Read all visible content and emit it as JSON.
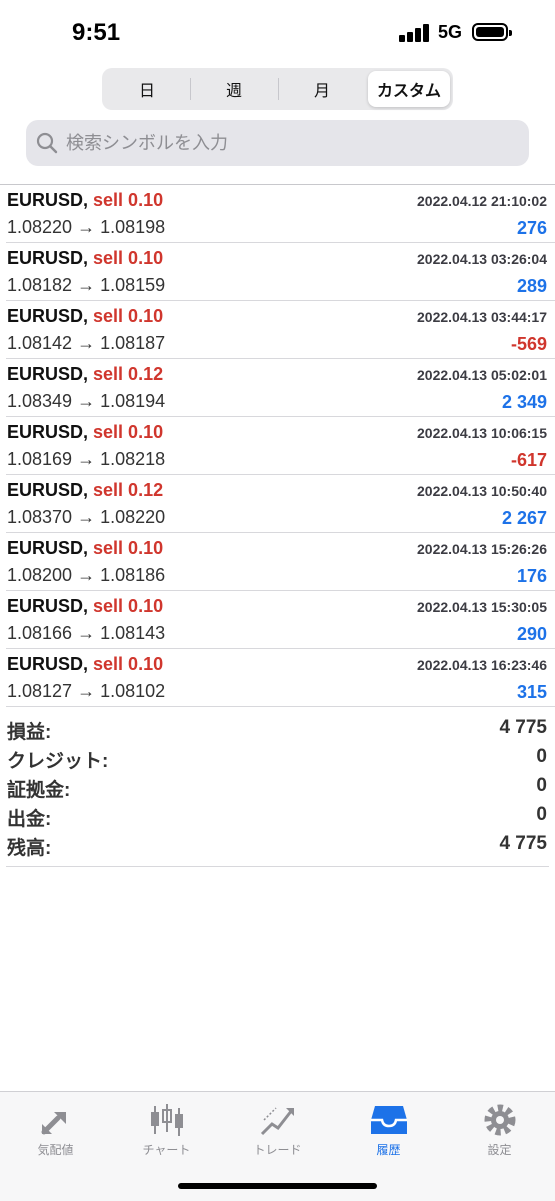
{
  "status_bar": {
    "time": "9:51",
    "network": "5G"
  },
  "segments": [
    {
      "label": "日",
      "active": false
    },
    {
      "label": "週",
      "active": false
    },
    {
      "label": "月",
      "active": false
    },
    {
      "label": "カスタム",
      "active": true
    }
  ],
  "search": {
    "placeholder": "検索シンボルを入力",
    "value": ""
  },
  "trades": [
    {
      "symbol": "EURUSD,",
      "side": "sell 0.10",
      "open": "1.08220",
      "close": "1.08198",
      "arrow": "→",
      "time": "2022.04.12 21:10:02",
      "profit": "276",
      "positive": true
    },
    {
      "symbol": "EURUSD,",
      "side": "sell 0.10",
      "open": "1.08182",
      "close": "1.08159",
      "arrow": "→",
      "time": "2022.04.13 03:26:04",
      "profit": "289",
      "positive": true
    },
    {
      "symbol": "EURUSD,",
      "side": "sell 0.10",
      "open": "1.08142",
      "close": "1.08187",
      "arrow": "→",
      "time": "2022.04.13 03:44:17",
      "profit": "-569",
      "positive": false
    },
    {
      "symbol": "EURUSD,",
      "side": "sell 0.12",
      "open": "1.08349",
      "close": "1.08194",
      "arrow": "→",
      "time": "2022.04.13 05:02:01",
      "profit": "2 349",
      "positive": true
    },
    {
      "symbol": "EURUSD,",
      "side": "sell 0.10",
      "open": "1.08169",
      "close": "1.08218",
      "arrow": "→",
      "time": "2022.04.13 10:06:15",
      "profit": "-617",
      "positive": false
    },
    {
      "symbol": "EURUSD,",
      "side": "sell 0.12",
      "open": "1.08370",
      "close": "1.08220",
      "arrow": "→",
      "time": "2022.04.13 10:50:40",
      "profit": "2 267",
      "positive": true
    },
    {
      "symbol": "EURUSD,",
      "side": "sell 0.10",
      "open": "1.08200",
      "close": "1.08186",
      "arrow": "→",
      "time": "2022.04.13 15:26:26",
      "profit": "176",
      "positive": true
    },
    {
      "symbol": "EURUSD,",
      "side": "sell 0.10",
      "open": "1.08166",
      "close": "1.08143",
      "arrow": "→",
      "time": "2022.04.13 15:30:05",
      "profit": "290",
      "positive": true
    },
    {
      "symbol": "EURUSD,",
      "side": "sell 0.10",
      "open": "1.08127",
      "close": "1.08102",
      "arrow": "→",
      "time": "2022.04.13 16:23:46",
      "profit": "315",
      "positive": true
    }
  ],
  "summary": [
    {
      "label": "損益:",
      "value": "4 775"
    },
    {
      "label": "クレジット:",
      "value": "0"
    },
    {
      "label": "証拠金:",
      "value": "0"
    },
    {
      "label": "出金:",
      "value": "0"
    },
    {
      "label": "残高:",
      "value": "4 775"
    }
  ],
  "tabs": [
    {
      "label": "気配値",
      "icon": "quotes-arrows-icon",
      "active": false
    },
    {
      "label": "チャート",
      "icon": "candlestick-chart-icon",
      "active": false
    },
    {
      "label": "トレード",
      "icon": "trade-chart-icon",
      "active": false
    },
    {
      "label": "履歴",
      "icon": "history-inbox-icon",
      "active": true
    },
    {
      "label": "設定",
      "icon": "gear-icon",
      "active": false
    }
  ],
  "colors": {
    "accent": "#1d72e8",
    "sell": "#d0362d",
    "negative": "#d0362d",
    "positive": "#1d72e8",
    "inactive_icon": "#8e8e93"
  }
}
